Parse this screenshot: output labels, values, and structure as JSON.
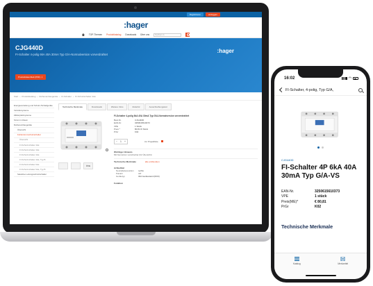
{
  "site": {
    "top_buttons": [
      "Registrieren",
      "einloggen"
    ],
    "logo": ":hager",
    "nav": [
      "TOP-Themen",
      "Produktkatalog",
      "Downloads",
      "Über uns"
    ],
    "search_placeholder": "Suchen in",
    "hero": {
      "title": "CJG440D",
      "subtitle": "FI-Schalter 4-polig 6kA 40A 30mA Typ G/A-Normalversion vorverdrahtet",
      "logo": ":hager",
      "pdf_button": "Produktdatenblatt (PDF)"
    },
    "breadcrumb": [
      "Start",
      "Produktkatalog",
      "Reiheneinbaugeräte",
      "FI-Schalter",
      "FI-Schutzschalter 4LE"
    ],
    "sidebar": [
      {
        "label": "Energieverteilung und Schutz-/Schaltgeräte",
        "level": 0
      },
      {
        "label": "Verteilersysteme",
        "level": 1
      },
      {
        "label": "Zählerplatzsysteme",
        "level": 1
      },
      {
        "label": "Strom im Raum",
        "level": 1
      },
      {
        "label": "Reiheneinbaugeräte",
        "level": 1
      },
      {
        "label": "Übersicht",
        "level": 2
      },
      {
        "label": "Fehlerstromschutzschalter",
        "level": 2,
        "active": true
      },
      {
        "label": "Übersicht",
        "level": 3
      },
      {
        "label": "FI-Schutzschalter 4LE",
        "level": 3
      },
      {
        "label": "FI-Schutzschalter 4LE",
        "level": 3
      },
      {
        "label": "FI-Schutzschalter 4LE",
        "level": 3
      },
      {
        "label": "FI-Schutzschalter 4LE, Typ B",
        "level": 3
      },
      {
        "label": "FI-Schutzschalter 6LE",
        "level": 3
      },
      {
        "label": "FI-Schutzschalter 6LE, Typ B",
        "level": 3
      },
      {
        "label": "Selektive Leitungsschutzschalter",
        "level": 2
      }
    ],
    "tabs": [
      "Technische Merkmale",
      "Downloads",
      "Weitere Infos",
      "Zubehör",
      "Ausschreibungstext"
    ],
    "product": {
      "title": "FI-Schalter 4-polig 6kA 40A 30mA Typ G/A-Normalversion vorverdrahtet",
      "specs": [
        {
          "k": "Best-Nr.",
          "v": "CJG440D"
        },
        {
          "k": "EAN-Nr.",
          "v": "3250615610373"
        },
        {
          "k": "VPE",
          "v": "1 Stück"
        },
        {
          "k": "Preis *",
          "v": "80,81 €/ Stück"
        },
        {
          "k": "PrGr",
          "v": "K02"
        }
      ],
      "qty": "1",
      "cart_link": "zur Projektliste",
      "thumbs": [
        "",
        "",
        "ÖVE"
      ],
      "hint_title": "Wichtiger Hinweis",
      "hint_text": "Mit Nennstrom vorsicherbar (für Übersicht)",
      "features_title": "Technische Merkmale",
      "features_link": "alle einblenden",
      "section2": "Artikeltitel",
      "features": [
        {
          "k": "Neutralleiterposition",
          "v": "rechts"
        },
        {
          "k": "Polzahl",
          "v": "4 P"
        },
        {
          "k": "Gerätetyp",
          "v": "30A Gerätestand (RCD)"
        }
      ],
      "section3": "Funktion"
    }
  },
  "phone": {
    "time": "16:02",
    "header_title": "FI-Schalter, 4-polig, Typ G/A,",
    "product_code": "CJG440D",
    "product_name": "FI-Schalter 4P 6kA 40A 30mA Typ G/A-VS",
    "specs": [
      {
        "k": "EAN-Nr.",
        "v": "3250615610373"
      },
      {
        "k": "VPE",
        "v": "1 stück"
      },
      {
        "k": "Preis(ME)*",
        "v": "€ 80,81"
      },
      {
        "k": "PrGr",
        "v": "K02"
      }
    ],
    "section": "Technische Merkmale",
    "tabbar": [
      "Katalog",
      "Merkzettel"
    ]
  },
  "colors": {
    "brand_blue": "#0b62a4",
    "accent_orange": "#e8471f",
    "device_dark": "#1a1a1c"
  }
}
